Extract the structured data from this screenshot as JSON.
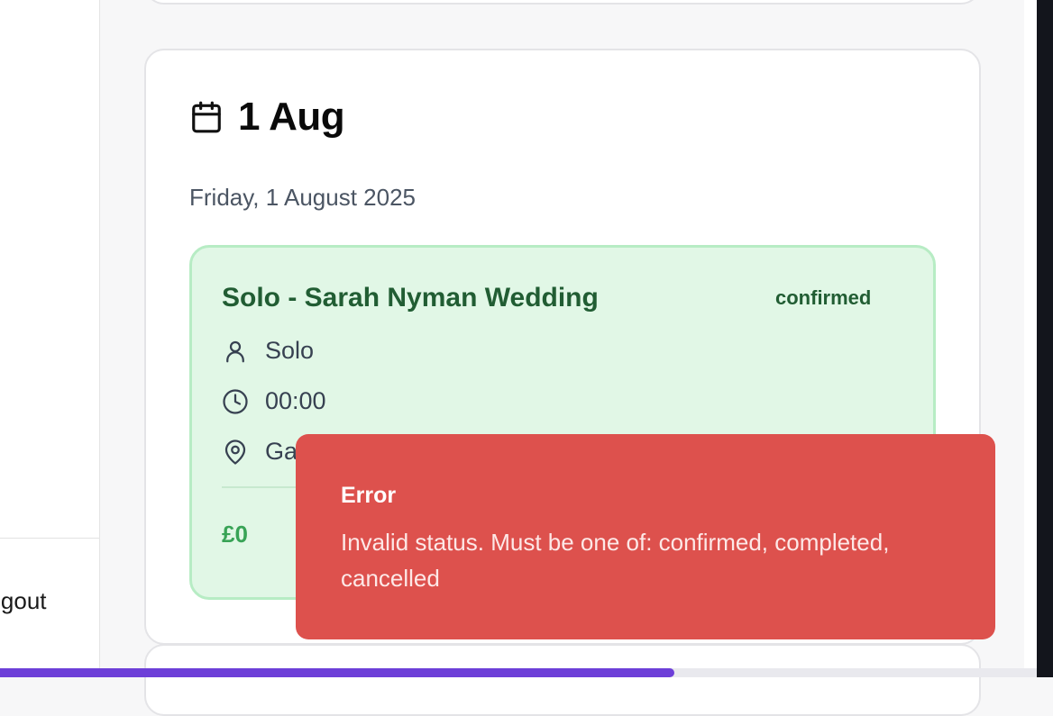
{
  "sidebar": {
    "logout_label": "Logout"
  },
  "day": {
    "title": "1 Aug",
    "subtitle": "Friday, 1 August 2025",
    "icon": "calendar-icon"
  },
  "event": {
    "title": "Solo - Sarah Nyman Wedding",
    "status": "confirmed",
    "act": "Solo",
    "time": "00:00",
    "venue": "Ga",
    "fee": "£0",
    "colors": {
      "background": "#e1f7e6",
      "border": "#b7ecc4",
      "text": "#215d33",
      "fee": "#38a356"
    }
  },
  "toast": {
    "title": "Error",
    "message": "Invalid status. Must be one of: confirmed, completed, cancelled",
    "color": "#dd514d"
  },
  "progress": {
    "fraction": 0.65,
    "color": "#6d3fd8"
  }
}
